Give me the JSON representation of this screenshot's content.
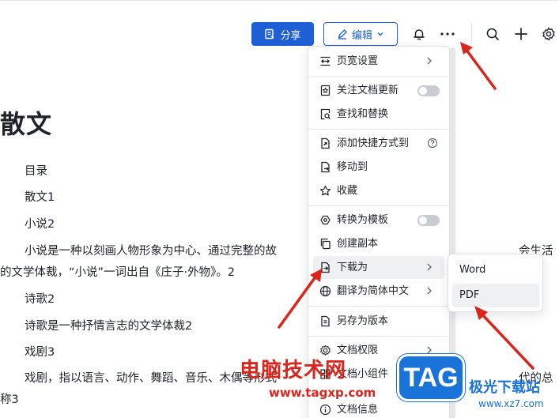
{
  "toolbar": {
    "share_label": "分享",
    "edit_label": "编辑",
    "icons": [
      "bell-icon",
      "more-icon",
      "search-icon",
      "plus-icon",
      "settings-icon"
    ]
  },
  "document": {
    "title": "散文",
    "lines": [
      "目录",
      "散文1",
      "小说2",
      "小说是一种以刻画人物形象为中心、通过完整的故",
      "会生活",
      "的文学体裁，“小说”一词出自《庄子·外物》。2",
      "诗歌2",
      "诗歌是一种抒情言志的文学体裁2",
      "戏剧3",
      "戏剧，指以语言、动作、舞蹈、音乐、木偶等形式",
      "代的总",
      "称3"
    ]
  },
  "menu": {
    "items": [
      {
        "label": "页宽设置",
        "icon": "page-width-icon"
      },
      {
        "label": "关注文档更新",
        "icon": "follow-icon"
      },
      {
        "label": "查找和替换",
        "icon": "find-replace-icon"
      },
      {
        "label": "添加快捷方式到",
        "icon": "shortcut-icon"
      },
      {
        "label": "移动到",
        "icon": "move-icon"
      },
      {
        "label": "收藏",
        "icon": "star-icon"
      },
      {
        "label": "转换为模板",
        "icon": "template-icon"
      },
      {
        "label": "创建副本",
        "icon": "copy-icon"
      },
      {
        "label": "下载为",
        "icon": "download-icon"
      },
      {
        "label": "翻译为简体中文",
        "icon": "translate-icon"
      },
      {
        "label": "另存为版本",
        "icon": "save-version-icon"
      },
      {
        "label": "文档权限",
        "icon": "permission-icon"
      },
      {
        "label": "文档小组件",
        "icon": "widget-icon"
      },
      {
        "label": "文档信息",
        "icon": "info-icon"
      }
    ]
  },
  "submenu": {
    "items": [
      "Word",
      "PDF"
    ]
  },
  "watermark": {
    "site_cn": "电脑技术网",
    "site_url": "www.tagxp.com",
    "tag": "TAG",
    "right_cn": "极光下载站",
    "right_url": "www.xz7.com"
  },
  "colors": {
    "primary": "#1f5fd6",
    "annotation": "#d9251c",
    "menu_hover": "#eff0f1"
  }
}
